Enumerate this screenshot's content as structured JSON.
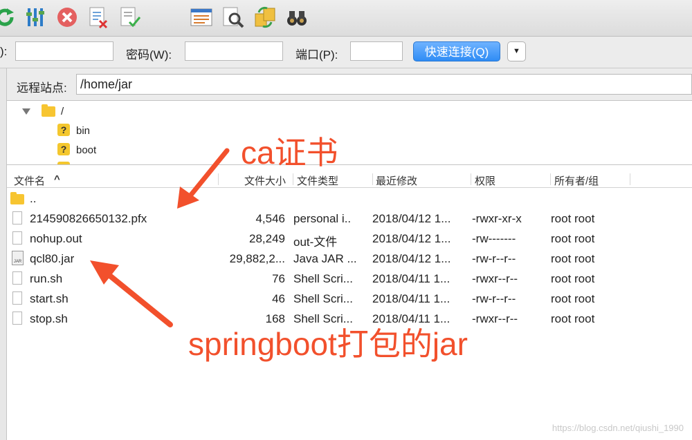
{
  "toolbar": {
    "buttons": [
      {
        "name": "refresh-icon"
      },
      {
        "name": "filter-settings-icon"
      },
      {
        "name": "cancel-icon"
      },
      {
        "name": "disconnect-icon"
      },
      {
        "name": "reconnect-icon"
      },
      {
        "name": "message-log-icon"
      },
      {
        "name": "search-files-icon"
      },
      {
        "name": "sync-browse-icon"
      },
      {
        "name": "binoculars-icon"
      }
    ]
  },
  "quickconnect": {
    "user_label_partial": "):",
    "password_label": "密码(W):",
    "port_label": "端口(P):",
    "connect_label": "快速连接(Q)",
    "dropdown_glyph": "▼"
  },
  "remote": {
    "site_label": "远程站点:",
    "path": "/home/jar"
  },
  "tree": [
    {
      "label": "/",
      "icon": "folder-icon"
    },
    {
      "label": "bin",
      "icon": "unknown-folder-icon"
    },
    {
      "label": "boot",
      "icon": "unknown-folder-icon"
    }
  ],
  "filelist": {
    "columns": {
      "name": "文件名",
      "size": "文件大小",
      "type": "文件类型",
      "modified": "最近修改",
      "perms": "权限",
      "owner": "所有者/组"
    },
    "sort_indicator": "^",
    "rows": [
      {
        "name": "..",
        "size": "",
        "type": "",
        "modified": "",
        "perms": "",
        "owner": "",
        "icon": "folder-icon"
      },
      {
        "name": "214590826650132.pfx",
        "size": "4,546",
        "type": "personal i..",
        "modified": "2018/04/12 1...",
        "perms": "-rwxr-xr-x",
        "owner": "root root",
        "icon": "file-icon"
      },
      {
        "name": "nohup.out",
        "size": "28,249",
        "type": "out-文件",
        "modified": "2018/04/12 1...",
        "perms": "-rw-------",
        "owner": "root root",
        "icon": "file-icon"
      },
      {
        "name": "qcl80.jar",
        "size": "29,882,2...",
        "type": "Java JAR ...",
        "modified": "2018/04/12 1...",
        "perms": "-rw-r--r--",
        "owner": "root root",
        "icon": "jar-icon"
      },
      {
        "name": "run.sh",
        "size": "76",
        "type": "Shell Scri...",
        "modified": "2018/04/11 1...",
        "perms": "-rwxr--r--",
        "owner": "root root",
        "icon": "file-icon"
      },
      {
        "name": "start.sh",
        "size": "46",
        "type": "Shell Scri...",
        "modified": "2018/04/11 1...",
        "perms": "-rw-r--r--",
        "owner": "root root",
        "icon": "file-icon"
      },
      {
        "name": "stop.sh",
        "size": "168",
        "type": "Shell Scri...",
        "modified": "2018/04/11 1...",
        "perms": "-rwxr--r--",
        "owner": "root root",
        "icon": "file-icon"
      }
    ]
  },
  "annotations": {
    "ca": "ca证书",
    "jar": "springboot打包的jar",
    "color": "#f2502c"
  },
  "watermark": "https://blog.csdn.net/qiushi_1990",
  "colors": {
    "accent_button": "#2f8cf5",
    "folder": "#f7c531"
  }
}
